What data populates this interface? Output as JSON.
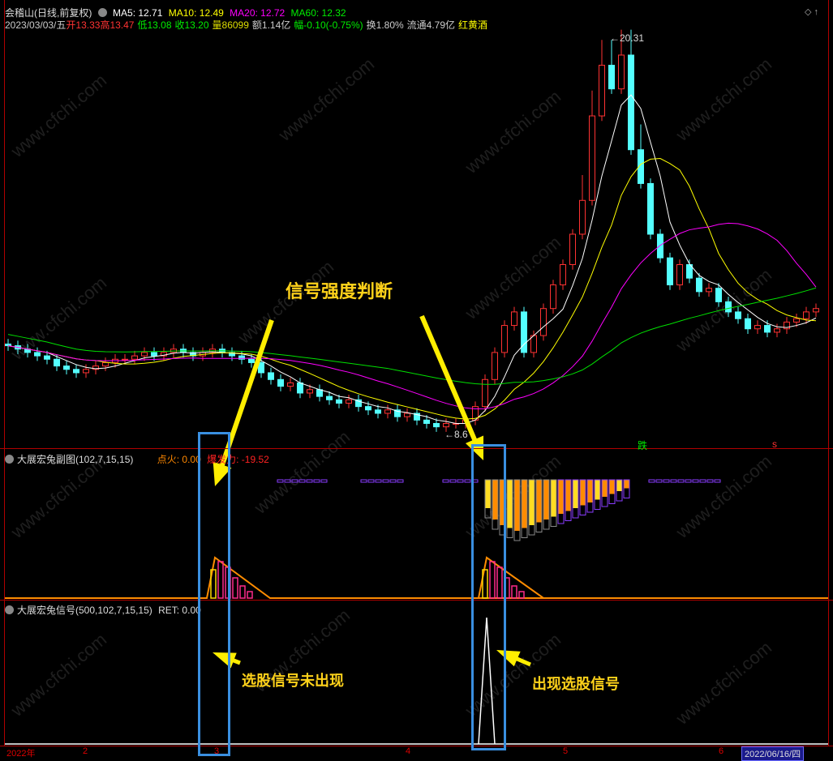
{
  "header": {
    "name": "会稽山",
    "mode": "(日线,前复权)",
    "ma5": "MA5: 12.71",
    "ma10": "MA10: 12.49",
    "ma20": "MA20: 12.72",
    "ma60": "MA60: 12.32",
    "date": "2023/03/03/五",
    "open": "开13.33",
    "high": "高13.47",
    "low": "低13.08",
    "close": "收13.20",
    "vol": "量86099",
    "amount": "额1.14亿",
    "chg": "幅-0.10(-0.75%)",
    "turnover": "换1.80%",
    "float": "流通4.79亿",
    "sector": "红黄酒"
  },
  "main": {
    "high_label": "20.31",
    "low_label": "8.6",
    "die_label": "跌",
    "s_label": "s",
    "closes": [
      11.2,
      11.1,
      11.0,
      10.9,
      10.8,
      10.6,
      10.5,
      10.4,
      10.5,
      10.6,
      10.7,
      10.8,
      10.8,
      10.9,
      11.0,
      10.9,
      11.0,
      11.1,
      11.0,
      10.9,
      11.0,
      11.1,
      11.0,
      10.9,
      10.8,
      10.7,
      10.4,
      10.2,
      10.0,
      10.1,
      9.8,
      9.9,
      9.7,
      9.6,
      9.5,
      9.6,
      9.4,
      9.3,
      9.2,
      9.3,
      9.1,
      9.2,
      9.0,
      8.9,
      8.8,
      8.9,
      8.9,
      9.0,
      9.4,
      10.2,
      11.0,
      11.8,
      12.2,
      11.0,
      11.5,
      12.3,
      13.0,
      13.6,
      14.5,
      15.5,
      18.0,
      19.5,
      18.8,
      19.8,
      17.0,
      16.0,
      14.5,
      13.8,
      13.0,
      13.6,
      13.2,
      12.8,
      12.9,
      12.5,
      12.2,
      12.0,
      11.7,
      11.8,
      11.6,
      11.7,
      11.9,
      12.0,
      12.2,
      12.3
    ],
    "colors": {
      "up": "#ff3232",
      "down": "#54ffff",
      "ma5": "#ffffff",
      "ma10": "#ffff00",
      "ma20": "#ff00ff",
      "ma60": "#00e000"
    }
  },
  "sub1": {
    "title": "大展宏兔副图(102,7,15,15)",
    "ignite": "点火: 0.00",
    "burst": "爆发力: -19.52",
    "bars": [
      10,
      14,
      16,
      17,
      18,
      17,
      16,
      15,
      14,
      13,
      12,
      11,
      10,
      9,
      8,
      7,
      6,
      5,
      4,
      3
    ]
  },
  "sub2": {
    "title": "大展宏兔信号(500,102,7,15,15)",
    "ret": "RET: 0.00"
  },
  "annotations": {
    "strength": "信号强度判断",
    "not_appear": "选股信号未出现",
    "appear": "出现选股信号"
  },
  "axis": {
    "year": "2022年",
    "m2": "2",
    "m3": "3",
    "m4": "4",
    "m5": "5",
    "m6": "6",
    "cursor_date": "2022/06/16/四"
  },
  "watermark": "www.cfchi.com"
}
